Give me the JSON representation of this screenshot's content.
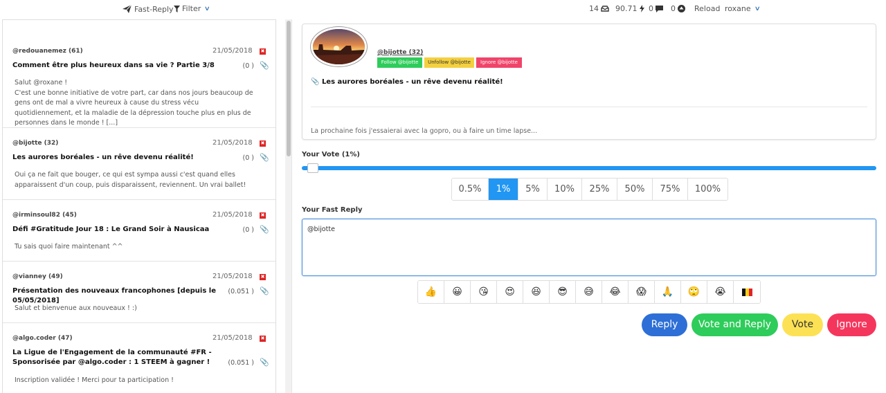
{
  "topbar": {
    "fast_reply": "Fast-Reply",
    "filter": "Filter",
    "stat_unread": "14",
    "stat_power": "90.71",
    "stat_comments": "0",
    "stat_votes": "0",
    "reload": "Reload",
    "user": "roxane"
  },
  "posts": [
    {
      "author": "@redouanemez (61)",
      "date": "21/05/2018",
      "title": "Comment être plus heureux dans sa vie ? Partie 3/8",
      "payout": "(0 )",
      "excerpt": "Salut @roxane !\nC'est une bonne initiative de votre part, car dans nos jours beaucoup de gens ont de mal a vivre heureux à cause du stress vécu quotidiennement, et la maladie de la dépression touche plus en plus de personnes dans le monde ! [...]"
    },
    {
      "author": "@bijotte (32)",
      "date": "21/05/2018",
      "title": "Les aurores boréales - un rêve devenu réalité!",
      "payout": "(0 )",
      "excerpt": "Oui ça ne fait que bouger, ce qui est sympa aussi c'est quand elles apparaissent d'un coup, puis disparaissent, reviennent. Un vrai ballet!"
    },
    {
      "author": "@irminsoul82 (45)",
      "date": "21/05/2018",
      "title": "Défi #Gratitude Jour 18 : Le Grand Soir à Nausicaa",
      "payout": "(0 )",
      "excerpt": "Tu sais quoi faire maintenant ^^"
    },
    {
      "author": "@vianney (49)",
      "date": "21/05/2018",
      "title": "Présentation des nouveaux francophones [depuis le 05/05/2018]",
      "payout": "(0.051 )",
      "excerpt": "Salut et bienvenue aux nouveaux ! :)"
    },
    {
      "author": "@algo.coder (47)",
      "date": "21/05/2018",
      "title": "La Ligue de l'Engagement de la communauté #FR - Sponsorisée par @algo.coder : 1 STEEM à gagner !",
      "payout": "(0.051 )",
      "excerpt": "Inscription validée ! Merci pour ta participation !"
    }
  ],
  "detail": {
    "author": "@bijotte (32)",
    "follow": "Follow @bijotte",
    "unfollow": "Unfollow @bijotte",
    "ignore": "Ignore @bijotte",
    "title": "Les aurores boréales - un rêve devenu réalité!",
    "excerpt": "La prochaine fois j'essaierai avec la gopro, ou à faire un time lapse..."
  },
  "vote": {
    "label": "Your Vote (1%)",
    "level": 0.01,
    "options": [
      "0.5%",
      "1%",
      "5%",
      "10%",
      "25%",
      "50%",
      "75%",
      "100%"
    ],
    "selected": "1%"
  },
  "reply": {
    "label": "Your Fast Reply",
    "value": "@bijotte"
  },
  "emojis": [
    "👍",
    "😀",
    "😘",
    "😍",
    "😆",
    "😎",
    "😅",
    "😂",
    "😱",
    "🙏",
    "🙄",
    "😭",
    "🇧🇪"
  ],
  "actions": {
    "reply": "Reply",
    "vote_reply": "Vote and Reply",
    "vote": "Vote",
    "ignore": "Ignore"
  },
  "colors": {
    "accent": "#2196f3",
    "follow": "#2ecc5a",
    "unfollow": "#f4d03f",
    "ignore": "#f0446a",
    "reply_button": "#2d6fd6",
    "vote_reply_button": "#2ecc5a",
    "vote_button": "#fde154",
    "ignore_button": "#f5365c"
  }
}
